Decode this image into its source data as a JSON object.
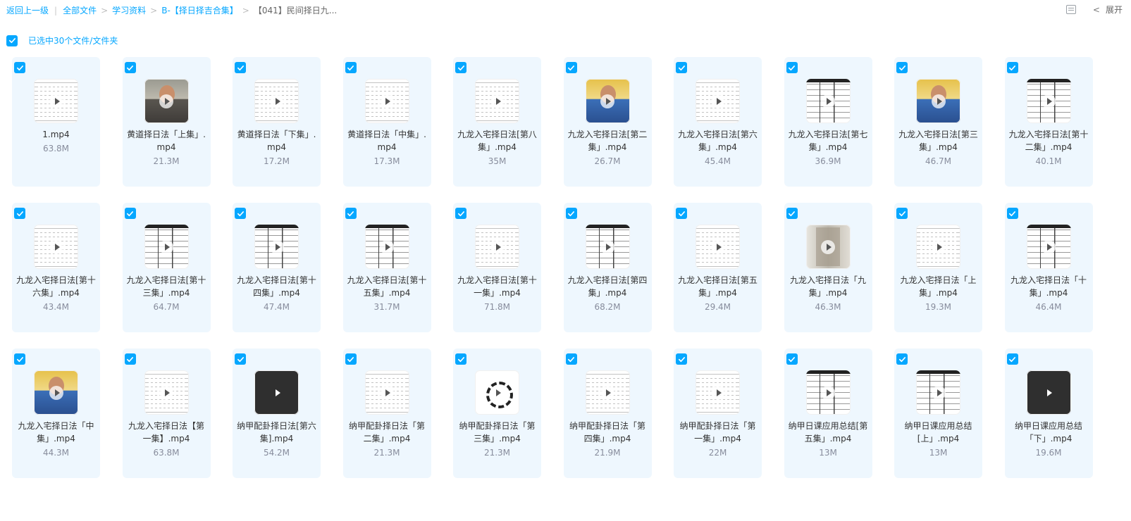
{
  "breadcrumb": {
    "back": "返回上一级",
    "items": [
      "全部文件",
      "学习资料",
      "B-【择日择吉合集】",
      "【041】民间择日九..."
    ]
  },
  "toolbar": {
    "expand_label": "展开"
  },
  "selection": {
    "text": "已选中30个文件/文件夹",
    "checked": true
  },
  "colors": {
    "accent": "#06a7ff",
    "card_bg": "#eef7fe"
  },
  "files": [
    {
      "name": "1.mp4",
      "size": "63.8M",
      "thumb": "doc"
    },
    {
      "name": "黄道择日法「上集」.mp4",
      "size": "21.3M",
      "thumb": "person-grey"
    },
    {
      "name": "黄道择日法「下集」.mp4",
      "size": "17.2M",
      "thumb": "doc"
    },
    {
      "name": "黄道择日法「中集」.mp4",
      "size": "17.3M",
      "thumb": "doc"
    },
    {
      "name": "九龙入宅择日法[第八集」.mp4",
      "size": "35M",
      "thumb": "doc"
    },
    {
      "name": "九龙入宅择日法[第二集」.mp4",
      "size": "26.7M",
      "thumb": "person"
    },
    {
      "name": "九龙入宅择日法[第六集」.mp4",
      "size": "45.4M",
      "thumb": "doc"
    },
    {
      "name": "九龙入宅择日法[第七集」.mp4",
      "size": "36.9M",
      "thumb": "table"
    },
    {
      "name": "九龙入宅择日法[第三集」.mp4",
      "size": "46.7M",
      "thumb": "person"
    },
    {
      "name": "九龙入宅择日法[第十二集」.mp4",
      "size": "40.1M",
      "thumb": "table"
    },
    {
      "name": "九龙入宅择日法[第十六集」.mp4",
      "size": "43.4M",
      "thumb": "doc"
    },
    {
      "name": "九龙入宅择日法[第十三集」.mp4",
      "size": "64.7M",
      "thumb": "table"
    },
    {
      "name": "九龙入宅择日法[第十四集」.mp4",
      "size": "47.4M",
      "thumb": "table"
    },
    {
      "name": "九龙入宅择日法[第十五集」.mp4",
      "size": "31.7M",
      "thumb": "table"
    },
    {
      "name": "九龙入宅择日法[第十一集」.mp4",
      "size": "71.8M",
      "thumb": "doc"
    },
    {
      "name": "九龙入宅择日法[第四集」.mp4",
      "size": "68.2M",
      "thumb": "table"
    },
    {
      "name": "九龙入宅择日法[第五集」.mp4",
      "size": "29.4M",
      "thumb": "doc"
    },
    {
      "name": "九龙入宅择日法「九集」.mp4",
      "size": "46.3M",
      "thumb": "photo"
    },
    {
      "name": "九龙入宅择日法「上集」.mp4",
      "size": "19.3M",
      "thumb": "doc"
    },
    {
      "name": "九龙入宅择日法「十集」.mp4",
      "size": "46.4M",
      "thumb": "table"
    },
    {
      "name": "九龙入宅择日法「中集」.mp4",
      "size": "44.3M",
      "thumb": "person"
    },
    {
      "name": "九龙入宅择日法【第一集】.mp4",
      "size": "63.8M",
      "thumb": "doc"
    },
    {
      "name": "纳甲配卦择日法[第六集].mp4",
      "size": "54.2M",
      "thumb": "dark"
    },
    {
      "name": "纳甲配卦择日法「第二集」.mp4",
      "size": "21.3M",
      "thumb": "doc"
    },
    {
      "name": "纳甲配卦择日法「第三集」.mp4",
      "size": "21.3M",
      "thumb": "bagua"
    },
    {
      "name": "纳甲配卦择日法「第四集」.mp4",
      "size": "21.9M",
      "thumb": "doc"
    },
    {
      "name": "纳甲配卦择日法「第一集」.mp4",
      "size": "22M",
      "thumb": "doc"
    },
    {
      "name": "纳甲日课应用总结[第五集」.mp4",
      "size": "13M",
      "thumb": "table"
    },
    {
      "name": "纳甲日课应用总结[上」.mp4",
      "size": "13M",
      "thumb": "table"
    },
    {
      "name": "纳甲日课应用总结「下」.mp4",
      "size": "19.6M",
      "thumb": "dark"
    }
  ]
}
